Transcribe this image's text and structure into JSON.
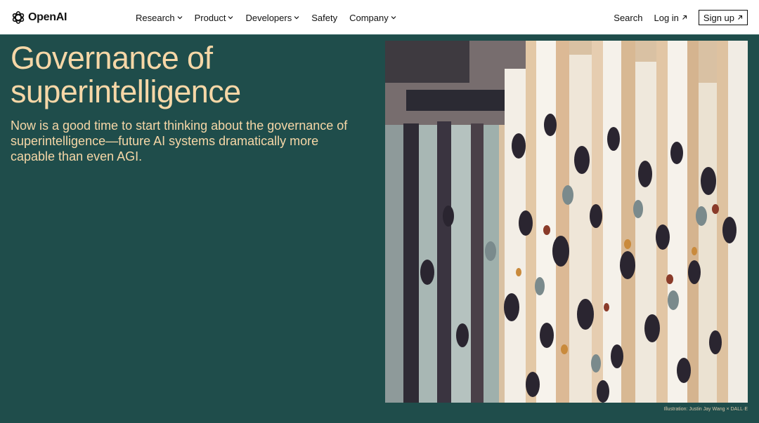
{
  "header": {
    "logo_text": "OpenAI",
    "nav": [
      {
        "label": "Research",
        "has_dropdown": true
      },
      {
        "label": "Product",
        "has_dropdown": true
      },
      {
        "label": "Developers",
        "has_dropdown": true
      },
      {
        "label": "Safety",
        "has_dropdown": false
      },
      {
        "label": "Company",
        "has_dropdown": true
      }
    ],
    "search_label": "Search",
    "login_label": "Log in",
    "signup_label": "Sign up"
  },
  "hero": {
    "title_line1": "Governance of",
    "title_line2": "superintelligence",
    "subtitle": "Now is a good time to start thinking about the governance of superintelligence—future AI systems dramatically more capable than even AGI.",
    "caption": "Illustration: Justin Jay Wang × DALL·E"
  },
  "colors": {
    "background": "#1f4d4b",
    "accent_text": "#f6d7a7",
    "header_bg": "#ffffff"
  },
  "icons": {
    "logo": "openai-logo-icon",
    "dropdown": "chevron-down-icon",
    "external": "arrow-up-right-icon"
  }
}
